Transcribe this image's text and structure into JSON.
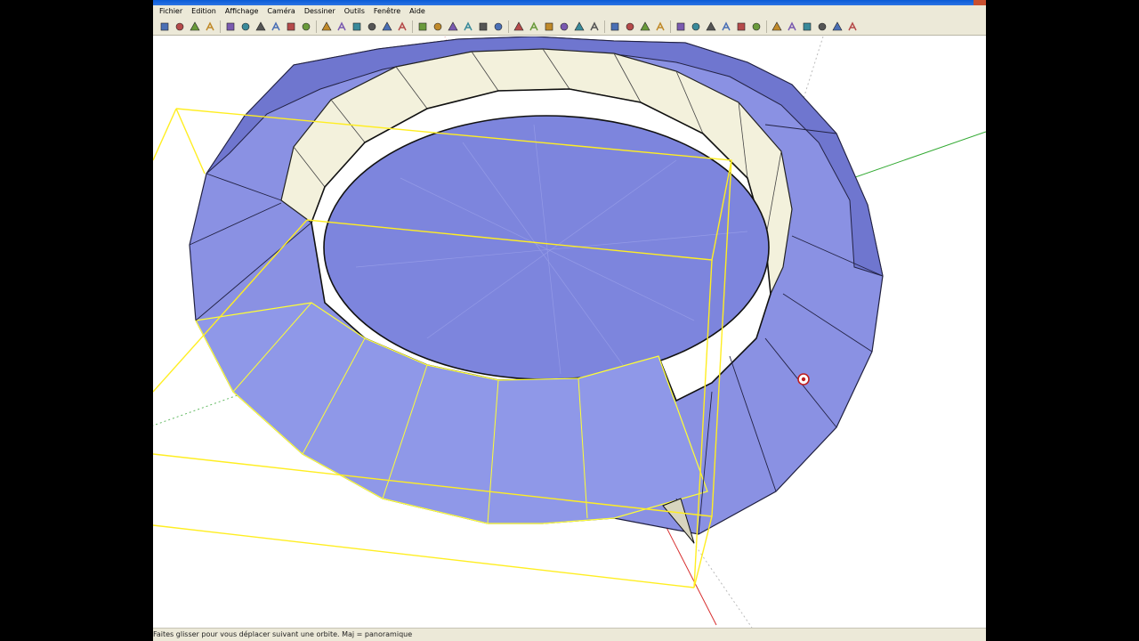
{
  "menu": {
    "items": [
      "Fichier",
      "Edition",
      "Affichage",
      "Caméra",
      "Dessiner",
      "Outils",
      "Fenêtre",
      "Aide"
    ]
  },
  "toolbar": {
    "tools": [
      "select-icon",
      "eraser-icon",
      "paint-bucket-icon",
      "component-icon",
      "sep",
      "rectangle-icon",
      "line-icon",
      "circle-icon",
      "arc-icon",
      "polygon-icon",
      "freehand-icon",
      "sep",
      "move-icon",
      "push-pull-icon",
      "rotate-icon",
      "follow-me-icon",
      "scale-icon",
      "offset-icon",
      "sep",
      "tape-measure-icon",
      "dimension-icon",
      "protractor-icon",
      "text-icon",
      "axes-icon",
      "3d-text-icon",
      "sep",
      "orbit-icon",
      "pan-icon",
      "zoom-icon",
      "zoom-window-icon",
      "zoom-extents-icon",
      "previous-view-icon",
      "sep",
      "walk-icon",
      "look-around-icon",
      "position-camera-icon",
      "section-plane-icon",
      "sep",
      "iso-view-icon",
      "top-view-icon",
      "front-view-icon",
      "right-view-icon",
      "back-view-icon",
      "left-view-icon",
      "sep",
      "xray-icon",
      "wireframe-icon",
      "hidden-line-icon",
      "shaded-icon",
      "shaded-texture-icon",
      "monochrome-icon"
    ]
  },
  "status": {
    "text": "Faites glisser pour vous déplacer suivant une orbite.  Maj = panoramique"
  },
  "colors": {
    "face_blue": "#8088e0",
    "face_cream": "#f1efd9",
    "selection": "#ffff33",
    "ui_bg": "#ece9d8"
  }
}
